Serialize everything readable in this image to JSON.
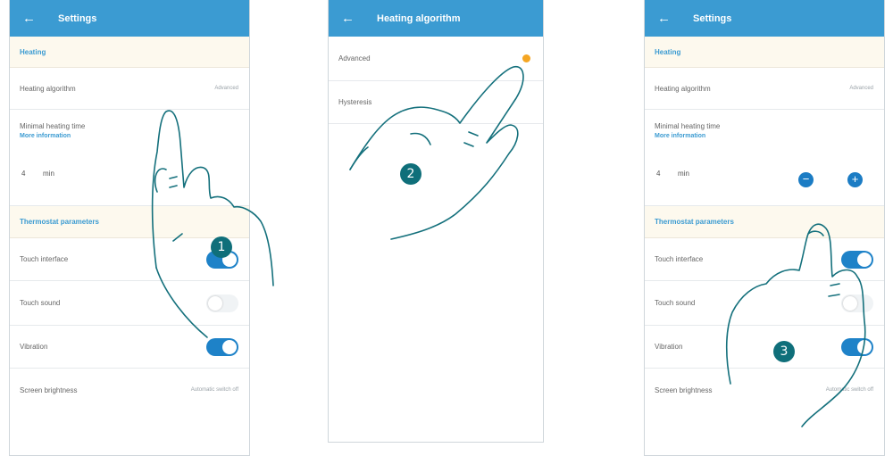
{
  "screen1": {
    "header": {
      "title": "Settings"
    },
    "section_heating": "Heating",
    "algorithm": {
      "label": "Heating algorithm",
      "value": "Advanced"
    },
    "min_time": {
      "label": "Minimal heating time",
      "link": "More information",
      "value": "4",
      "unit": "min"
    },
    "section_thermostat": "Thermostat parameters",
    "touch_interface": {
      "label": "Touch interface",
      "on": true
    },
    "touch_sound": {
      "label": "Touch sound",
      "on": false
    },
    "vibration": {
      "label": "Vibration",
      "on": true
    },
    "brightness": {
      "label": "Screen brightness",
      "value": "Automatic switch off"
    },
    "step_number": "1"
  },
  "screen2": {
    "header": {
      "title": "Heating algorithm"
    },
    "options": [
      {
        "label": "Advanced",
        "selected": true
      },
      {
        "label": "Hysteresis",
        "selected": false
      }
    ],
    "step_number": "2"
  },
  "screen3": {
    "header": {
      "title": "Settings"
    },
    "section_heating": "Heating",
    "algorithm": {
      "label": "Heating algorithm",
      "value": "Advanced"
    },
    "min_time": {
      "label": "Minimal heating time",
      "link": "More information",
      "value": "4",
      "unit": "min",
      "minus": "−",
      "plus": "+"
    },
    "section_thermostat": "Thermostat parameters",
    "touch_interface": {
      "label": "Touch interface",
      "on": true
    },
    "touch_sound": {
      "label": "Touch sound",
      "on": false
    },
    "vibration": {
      "label": "Vibration",
      "on": true
    },
    "brightness": {
      "label": "Screen brightness",
      "value": "Automatic switch off"
    },
    "step_number": "3"
  },
  "colors": {
    "header": "#3b9bd2",
    "toggle_on": "#1e82c8",
    "badge": "#0f6f7a",
    "selected_radio": "#f5a623"
  },
  "icons": {
    "back": "arrow-left-icon"
  }
}
